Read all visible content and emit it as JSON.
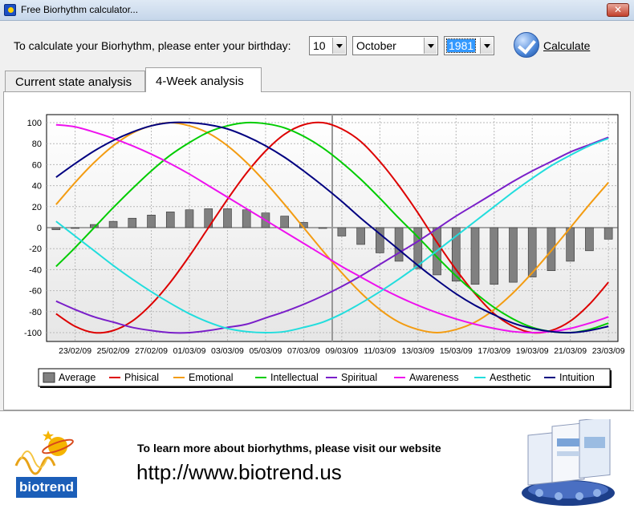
{
  "window": {
    "title": "Free Biorhythm calculator...",
    "close_glyph": "✕"
  },
  "form": {
    "prompt": "To calculate your Biorhythm, please enter your birthday:",
    "day": "10",
    "month": "October",
    "year": "1981",
    "calculate_label": "Calculate"
  },
  "tabs": {
    "current": "Current state analysis",
    "four_week": "4-Week analysis"
  },
  "promo": {
    "text": "To learn more about biorhythms, please visit our website",
    "url": "http://www.biotrend.us",
    "logo_text": "biotrend"
  },
  "chart_data": {
    "type": "line",
    "ylim": [
      -100,
      100
    ],
    "yticks": [
      100,
      80,
      60,
      40,
      20,
      0,
      -20,
      -40,
      -60,
      -80,
      -100
    ],
    "x_tick_labels": [
      "23/02/09",
      "25/02/09",
      "27/02/09",
      "01/03/09",
      "03/03/09",
      "05/03/09",
      "07/03/09",
      "09/03/09",
      "11/03/09",
      "13/03/09",
      "15/03/09",
      "17/03/09",
      "19/03/09",
      "21/03/09",
      "23/03/09"
    ],
    "grid": true,
    "today_marker_index": 15,
    "legend_position": "bottom",
    "series": [
      {
        "name": "Average",
        "kind": "bar",
        "color": "#808080",
        "values": [
          -2,
          0,
          3,
          6,
          9,
          12,
          15,
          17,
          18,
          18,
          17,
          14,
          11,
          5,
          0,
          -8,
          -16,
          -24,
          -32,
          -39,
          -45,
          -51,
          -54,
          -54,
          -52,
          -47,
          -41,
          -32,
          -22,
          -11
        ]
      },
      {
        "name": "Phisical",
        "color": "#dd0000",
        "values": [
          -82,
          -94,
          -100,
          -98,
          -89,
          -73,
          -52,
          -27,
          0,
          27,
          52,
          73,
          89,
          98,
          100,
          94,
          82,
          63,
          40,
          14,
          -14,
          -40,
          -63,
          -82,
          -94,
          -100,
          -98,
          -89,
          -73,
          -52
        ]
      },
      {
        "name": "Emotional",
        "color": "#f39c12",
        "values": [
          22,
          43,
          62,
          78,
          90,
          97,
          100,
          97,
          90,
          78,
          62,
          43,
          22,
          0,
          -22,
          -43,
          -62,
          -78,
          -90,
          -97,
          -100,
          -97,
          -90,
          -78,
          -62,
          -43,
          -22,
          0,
          22,
          43
        ]
      },
      {
        "name": "Intellectual",
        "color": "#00cc00",
        "values": [
          -37,
          -19,
          0,
          19,
          37,
          54,
          69,
          81,
          91,
          97,
          100,
          99,
          95,
          87,
          76,
          62,
          46,
          28,
          9,
          -9,
          -28,
          -46,
          -62,
          -76,
          -87,
          -95,
          -99,
          -100,
          -97,
          -91
        ]
      },
      {
        "name": "Spiritual",
        "color": "#7a1fc9",
        "values": [
          -70,
          -78,
          -85,
          -90,
          -95,
          -98,
          -100,
          -100,
          -98,
          -95,
          -92,
          -86,
          -80,
          -73,
          -65,
          -56,
          -46,
          -35,
          -24,
          -13,
          -1,
          11,
          22,
          33,
          44,
          54,
          63,
          72,
          79,
          86
        ]
      },
      {
        "name": "Awareness",
        "color": "#ee11ee",
        "values": [
          98,
          96,
          91,
          85,
          78,
          70,
          61,
          51,
          40,
          29,
          18,
          7,
          -4,
          -15,
          -26,
          -37,
          -47,
          -57,
          -66,
          -74,
          -81,
          -87,
          -92,
          -96,
          -99,
          -100,
          -99,
          -96,
          -91,
          -85
        ]
      },
      {
        "name": "Aesthetic",
        "color": "#22dddd",
        "values": [
          6,
          -8,
          -22,
          -36,
          -49,
          -61,
          -72,
          -82,
          -90,
          -96,
          -99,
          -100,
          -99,
          -95,
          -90,
          -82,
          -72,
          -61,
          -49,
          -36,
          -22,
          -8,
          6,
          20,
          34,
          47,
          59,
          69,
          78,
          85
        ]
      },
      {
        "name": "Intuition",
        "color": "#000080",
        "values": [
          48,
          61,
          73,
          83,
          91,
          97,
          100,
          100,
          98,
          94,
          87,
          78,
          67,
          54,
          40,
          25,
          9,
          -6,
          -21,
          -36,
          -50,
          -63,
          -74,
          -83,
          -91,
          -96,
          -99,
          -100,
          -98,
          -94
        ]
      }
    ]
  }
}
